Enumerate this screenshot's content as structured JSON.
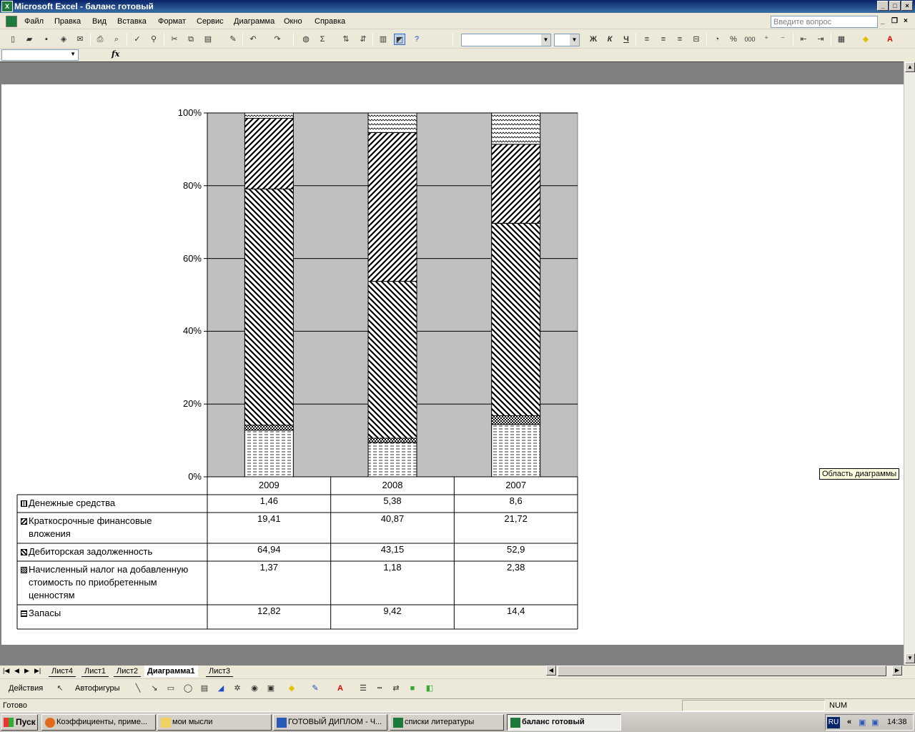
{
  "window": {
    "title": "Microsoft Excel - баланс готовый"
  },
  "menu": {
    "items": [
      "Файл",
      "Правка",
      "Вид",
      "Вставка",
      "Формат",
      "Сервис",
      "Диаграмма",
      "Окно",
      "Справка"
    ],
    "help_placeholder": "Введите вопрос"
  },
  "toolbar": {
    "icons": [
      "new-icon",
      "open-icon",
      "save-icon",
      "permission-icon",
      "print-icon",
      "print-preview-icon",
      "spelling-icon",
      "research-icon",
      "cut-icon",
      "copy-icon",
      "paste-icon",
      "format-painter-icon",
      "undo-icon",
      "redo-icon",
      "hyperlink-icon",
      "autosum-icon",
      "sort-asc-icon",
      "sort-desc-icon",
      "chart-wizard-icon",
      "drawing-icon",
      "help-icon"
    ],
    "bold": "Ж",
    "italic": "К",
    "underline": "Ч",
    "percent": "%",
    "thousands": "000"
  },
  "formula_bar": {
    "fx": "fx"
  },
  "chart_data": {
    "type": "bar",
    "stacked": "percent",
    "categories": [
      "2009",
      "2008",
      "2007"
    ],
    "ylim": [
      0,
      100
    ],
    "y_ticks": [
      "0%",
      "20%",
      "40%",
      "60%",
      "80%",
      "100%"
    ],
    "series": [
      {
        "name": "Запасы",
        "values": [
          12.82,
          9.42,
          14.4
        ],
        "display": [
          "12,82",
          "9,42",
          "14,4"
        ]
      },
      {
        "name": "Начисленный налог на добавленную стоимость по приобретенным ценностям",
        "values": [
          1.37,
          1.18,
          2.38
        ],
        "display": [
          "1,37",
          "1,18",
          "2,38"
        ]
      },
      {
        "name": "Дебиторская задолженность",
        "values": [
          64.94,
          43.15,
          52.9
        ],
        "display": [
          "64,94",
          "43,15",
          "52,9"
        ]
      },
      {
        "name": "Краткосрочные финансовые вложения",
        "values": [
          19.41,
          40.87,
          21.72
        ],
        "display": [
          "19,41",
          "40,87",
          "21,72"
        ]
      },
      {
        "name": "Денежные средства",
        "values": [
          1.46,
          5.38,
          8.6
        ],
        "display": [
          "1,46",
          "5,38",
          "8,6"
        ]
      }
    ],
    "table_rows": [
      {
        "label_lines": [
          "Денежные средства"
        ],
        "series_index": 4
      },
      {
        "label_lines": [
          "Краткосрочные финансовые",
          "вложения"
        ],
        "series_index": 3
      },
      {
        "label_lines": [
          "Дебиторская задолженность"
        ],
        "series_index": 2
      },
      {
        "label_lines": [
          "Начисленный налог на добавленную",
          "стоимость по приобретенным",
          "ценностям"
        ],
        "series_index": 1
      },
      {
        "label_lines": [
          "Запасы"
        ],
        "series_index": 0
      }
    ],
    "plot_background": "#c0c0c0",
    "grid": true
  },
  "tooltip": "Область диаграммы",
  "sheet_tabs": [
    "Лист4",
    "Лист1",
    "Лист2",
    "Диаграмма1",
    "Лист3"
  ],
  "active_tab": "Диаграмма1",
  "drawing_toolbar": {
    "actions": "Действия",
    "autoshapes": "Автофигуры"
  },
  "status": {
    "ready": "Готово",
    "num": "NUM"
  },
  "taskbar": {
    "start": "Пуск",
    "buttons": [
      "Коэффициенты, приме...",
      "мои мысли",
      "ГОТОВЫЙ ДИПЛОМ - Ч...",
      "списки литературы",
      "баланс готовый"
    ],
    "lang": "RU",
    "clock": "14:38"
  }
}
